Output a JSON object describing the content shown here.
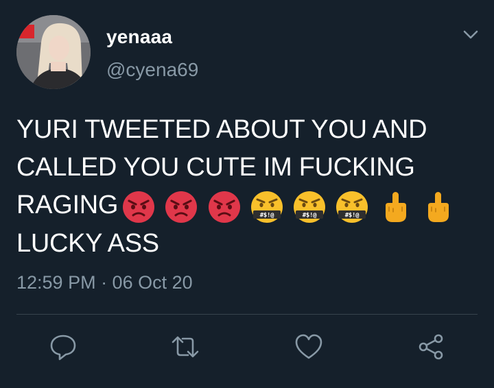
{
  "tweet": {
    "display_name": "yenaaa",
    "handle": "@cyena69",
    "text_lines": [
      "YURI TWEETED ABOUT YOU AND",
      "CALLED YOU CUTE IM FUCKING",
      "RAGING",
      "LUCKY ASS"
    ],
    "emojis": [
      "angry-face",
      "angry-face",
      "angry-face",
      "face-with-symbols-on-mouth",
      "face-with-symbols-on-mouth",
      "face-with-symbols-on-mouth",
      "middle-finger",
      "middle-finger"
    ],
    "timestamp": "12:59 PM · 06 Oct 20"
  },
  "actions": {
    "icons": [
      "reply-icon",
      "retweet-icon",
      "like-icon",
      "share-icon"
    ]
  },
  "colors": {
    "background": "#15202b",
    "text_primary": "#ffffff",
    "text_secondary": "#8899a6",
    "divider": "#38444d",
    "icon": "#8899a6",
    "angry_face": "#e0374a",
    "symbols_face": "#f9c02b",
    "hand": "#f4a91f"
  }
}
